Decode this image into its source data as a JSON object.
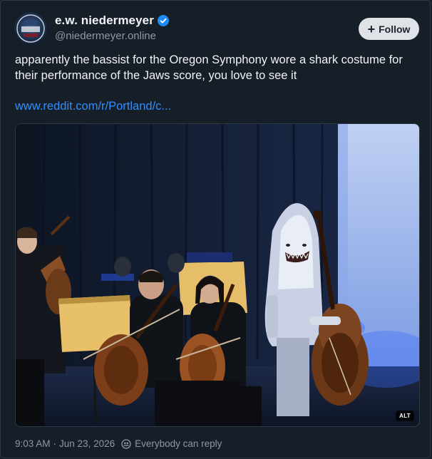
{
  "author": {
    "display_name": "e.w. niedermeyer",
    "handle": "@niedermeyer.online",
    "verified": true
  },
  "follow_button": {
    "label": "Follow",
    "icon": "plus-icon"
  },
  "post": {
    "text": "apparently the bassist for the Oregon Symphony wore a shark costume for their performance of the Jaws score, you love to see it",
    "link_text": "www.reddit.com/r/Portland/c..."
  },
  "media": {
    "alt_label": "ALT"
  },
  "footer": {
    "time": "9:03 AM",
    "separator": "·",
    "date": "Jun 23, 2026",
    "reply_setting": "Everybody can reply",
    "reply_icon": "people-icon"
  },
  "colors": {
    "background": "#161e27",
    "link": "#2f8fff",
    "verified": "#1d8cf7",
    "follow_button_bg": "#dfe3e8",
    "muted_text": "#8d99a5"
  }
}
